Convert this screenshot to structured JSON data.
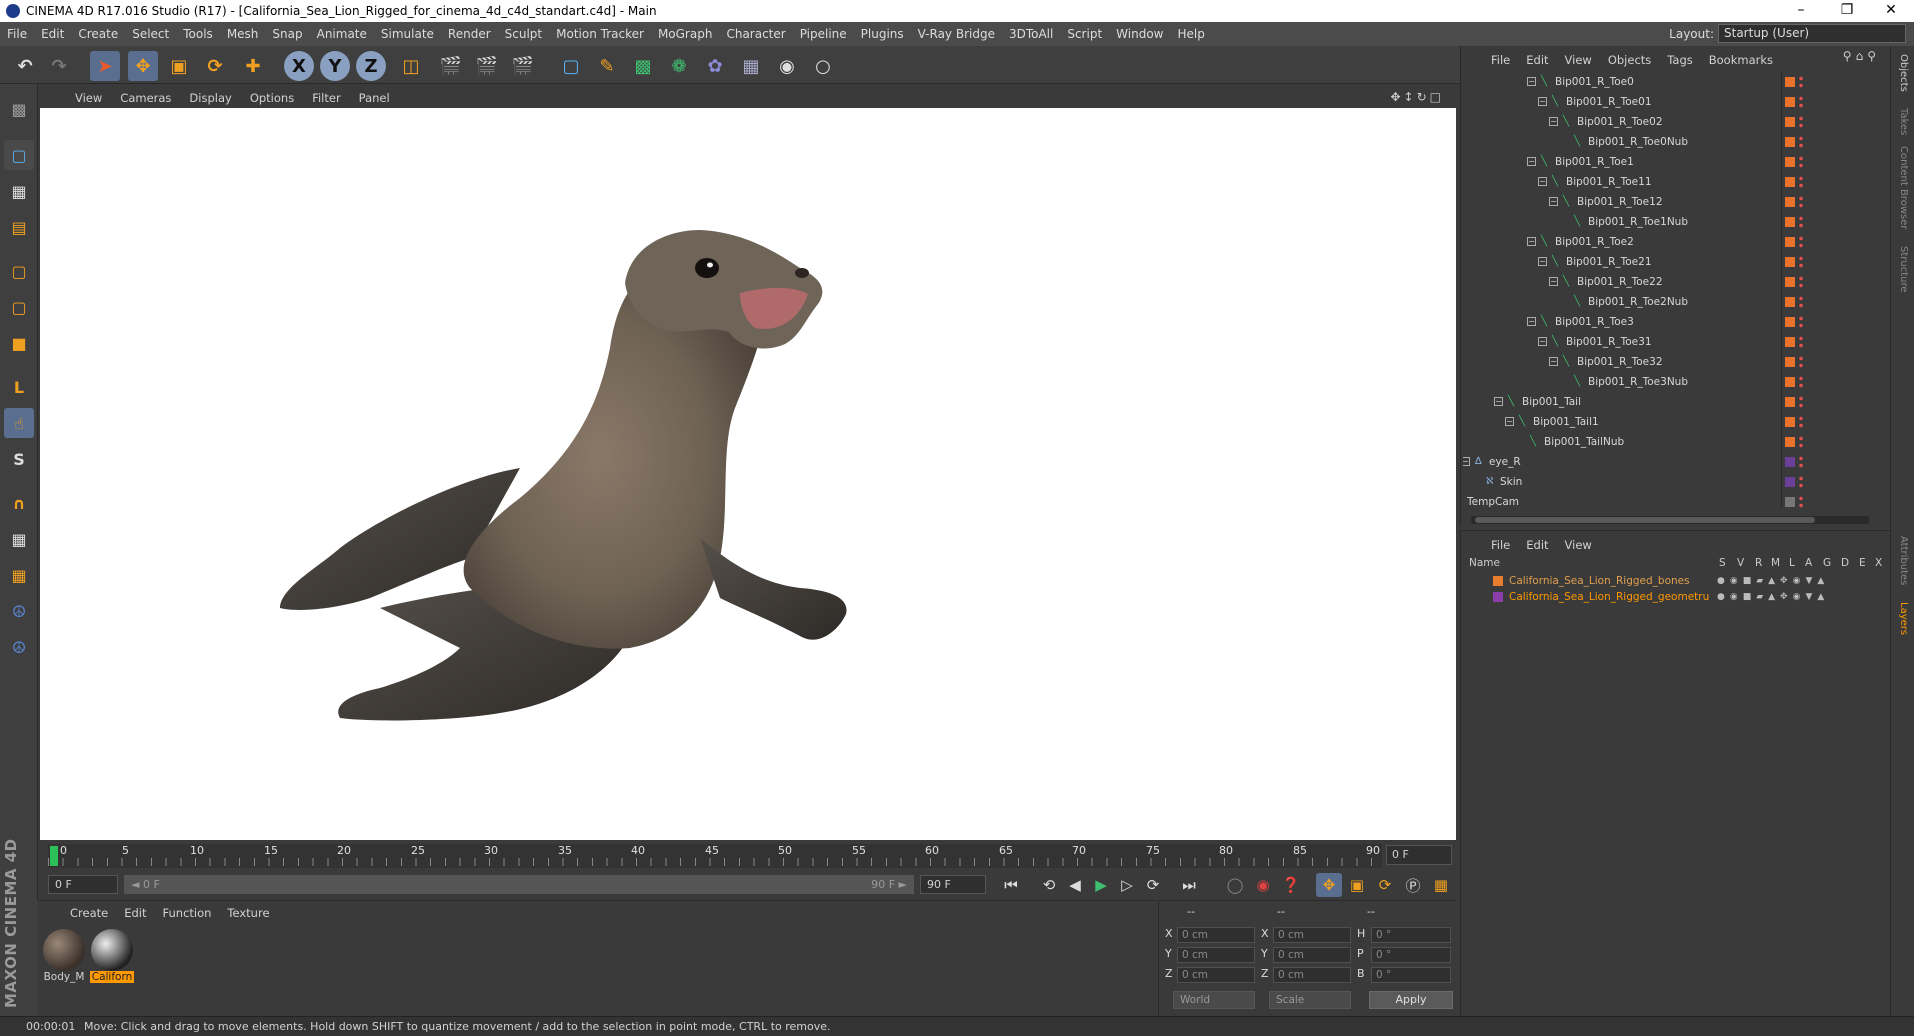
{
  "window": {
    "title": "CINEMA 4D R17.016 Studio (R17) - [California_Sea_Lion_Rigged_for_cinema_4d_c4d_standart.c4d] - Main",
    "controls": [
      "–",
      "❐",
      "✕"
    ]
  },
  "menubar": {
    "items": [
      "File",
      "Edit",
      "Create",
      "Select",
      "Tools",
      "Mesh",
      "Snap",
      "Animate",
      "Simulate",
      "Render",
      "Sculpt",
      "Motion Tracker",
      "MoGraph",
      "Character",
      "Pipeline",
      "Plugins",
      "V-Ray Bridge",
      "3DToAll",
      "Script",
      "Window",
      "Help"
    ],
    "layout_label": "Layout:",
    "layout_value": "Startup (User)"
  },
  "toolbar": {
    "axis_x": "X",
    "axis_y": "Y",
    "axis_z": "Z"
  },
  "viewport": {
    "menu": [
      "View",
      "Cameras",
      "Display",
      "Options",
      "Filter",
      "Panel"
    ],
    "nav_icons": "✥↕↻□"
  },
  "timeline": {
    "ticks": [
      "0",
      "5",
      "10",
      "15",
      "20",
      "25",
      "30",
      "35",
      "40",
      "45",
      "50",
      "55",
      "60",
      "65",
      "70",
      "75",
      "80",
      "85",
      "90"
    ],
    "current_frame": "0 F"
  },
  "transport": {
    "start_field": "0 F",
    "range_start": "◄ 0 F",
    "range_end": "90 F ►",
    "end_field": "90 F"
  },
  "materials": {
    "menu": [
      "Create",
      "Edit",
      "Function",
      "Texture"
    ],
    "items": [
      {
        "label": "Body_M",
        "selected": false
      },
      {
        "label": "Californ",
        "selected": true
      }
    ]
  },
  "coordinates": {
    "header": [
      "--",
      "--",
      "--"
    ],
    "rows": [
      {
        "a": "X",
        "a_val": "0 cm",
        "b": "X",
        "b_val": "0 cm",
        "c": "H",
        "c_val": "0 °"
      },
      {
        "a": "Y",
        "a_val": "0 cm",
        "b": "Y",
        "b_val": "0 cm",
        "c": "P",
        "c_val": "0 °"
      },
      {
        "a": "Z",
        "a_val": "0 cm",
        "b": "Z",
        "b_val": "0 cm",
        "c": "B",
        "c_val": "0 °"
      }
    ],
    "space": "World",
    "mode": "Scale",
    "apply": "Apply"
  },
  "branding": {
    "logo": "MAXON CINEMA 4D"
  },
  "status": {
    "time": "00:00:01",
    "message": "Move: Click and drag to move elements. Hold down SHIFT to quantize movement / add to the selection in point mode, CTRL to remove."
  },
  "objects": {
    "menu": [
      "File",
      "Edit",
      "View",
      "Objects",
      "Tags",
      "Bookmarks"
    ],
    "rows": [
      {
        "name": "Bip001_R_Toe0",
        "depth": 0,
        "exp": true
      },
      {
        "name": "Bip001_R_Toe01",
        "depth": 1,
        "exp": true
      },
      {
        "name": "Bip001_R_Toe02",
        "depth": 2,
        "exp": true
      },
      {
        "name": "Bip001_R_Toe0Nub",
        "depth": 3,
        "exp": false
      },
      {
        "name": "Bip001_R_Toe1",
        "depth": 0,
        "exp": true
      },
      {
        "name": "Bip001_R_Toe11",
        "depth": 1,
        "exp": true
      },
      {
        "name": "Bip001_R_Toe12",
        "depth": 2,
        "exp": true
      },
      {
        "name": "Bip001_R_Toe1Nub",
        "depth": 3,
        "exp": false
      },
      {
        "name": "Bip001_R_Toe2",
        "depth": 0,
        "exp": true
      },
      {
        "name": "Bip001_R_Toe21",
        "depth": 1,
        "exp": true
      },
      {
        "name": "Bip001_R_Toe22",
        "depth": 2,
        "exp": true
      },
      {
        "name": "Bip001_R_Toe2Nub",
        "depth": 3,
        "exp": false
      },
      {
        "name": "Bip001_R_Toe3",
        "depth": 0,
        "exp": true
      },
      {
        "name": "Bip001_R_Toe31",
        "depth": 1,
        "exp": true
      },
      {
        "name": "Bip001_R_Toe32",
        "depth": 2,
        "exp": true
      },
      {
        "name": "Bip001_R_Toe3Nub",
        "depth": 3,
        "exp": false
      },
      {
        "name": "Bip001_Tail",
        "depth": -3,
        "exp": true
      },
      {
        "name": "Bip001_Tail1",
        "depth": -2,
        "exp": true
      },
      {
        "name": "Bip001_TailNub",
        "depth": -1,
        "exp": false
      },
      {
        "name": "eye_R",
        "depth": -6,
        "exp": true,
        "kind": "null"
      },
      {
        "name": "Skin",
        "depth": -5,
        "exp": false,
        "kind": "skin"
      },
      {
        "name": "TempCam",
        "depth": -8,
        "exp": false,
        "kind": "camera"
      }
    ]
  },
  "layers": {
    "menu": [
      "File",
      "Edit",
      "View"
    ],
    "columns": [
      "Name",
      "S",
      "V",
      "R",
      "M",
      "L",
      "A",
      "G",
      "D",
      "E",
      "X"
    ],
    "rows": [
      {
        "name": "California_Sea_Lion_Rigged_bones",
        "color": "#e87d2e",
        "highlight": false
      },
      {
        "name": "California_Sea_Lion_Rigged_geometru",
        "color": "#8a3fa8",
        "highlight": true
      }
    ]
  },
  "right_tabs": [
    "Objects",
    "Takes",
    "Content Browser",
    "Structure",
    "Attributes",
    "Layers"
  ],
  "colors": {
    "accent": "#ff9900",
    "bone": "#3fbf6a",
    "tag_orange": "#e8712c",
    "selection": "#5a6f8f"
  }
}
